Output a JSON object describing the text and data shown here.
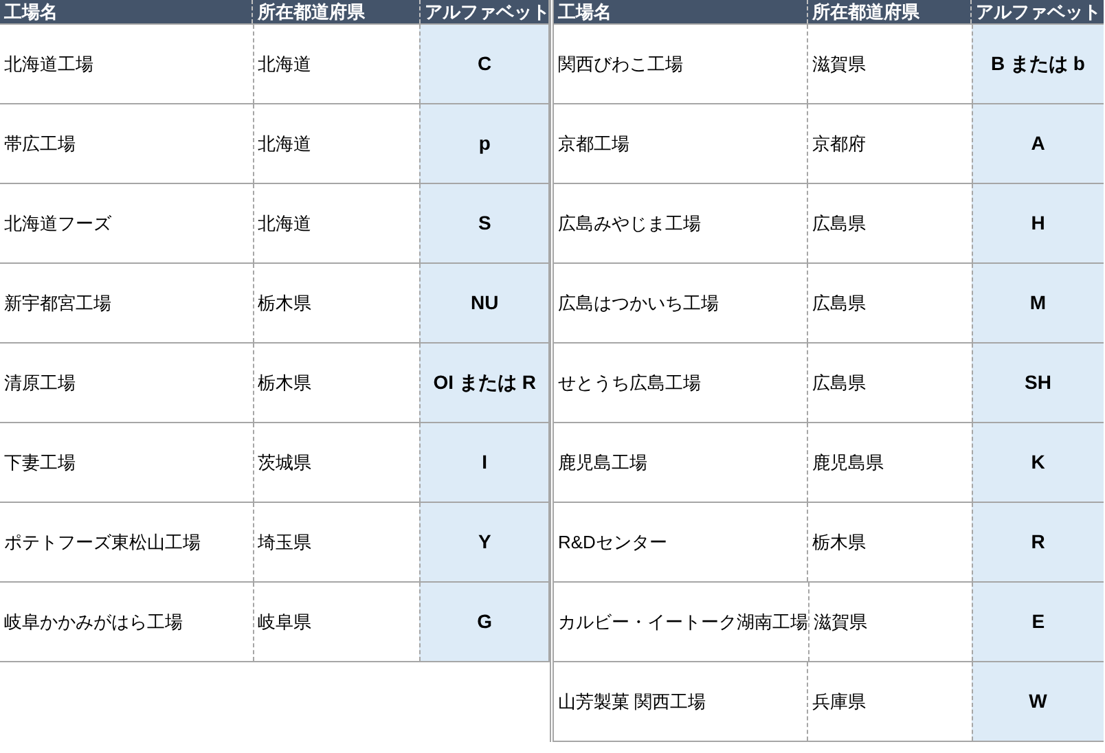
{
  "tables": [
    {
      "columns": [
        "工場名",
        "所在都道府県",
        "アルファベット"
      ],
      "rows": [
        {
          "name": "北海道工場",
          "prefecture": "北海道",
          "alphabet": "C"
        },
        {
          "name": "帯広工場",
          "prefecture": "北海道",
          "alphabet": "p"
        },
        {
          "name": "北海道フーズ",
          "prefecture": "北海道",
          "alphabet": "S"
        },
        {
          "name": "新宇都宮工場",
          "prefecture": "栃木県",
          "alphabet": "NU"
        },
        {
          "name": "清原工場",
          "prefecture": "栃木県",
          "alphabet": "OI または R"
        },
        {
          "name": "下妻工場",
          "prefecture": "茨城県",
          "alphabet": "I"
        },
        {
          "name": "ポテトフーズ東松山工場",
          "prefecture": "埼玉県",
          "alphabet": "Y"
        },
        {
          "name": "岐阜かかみがはら工場",
          "prefecture": "岐阜県",
          "alphabet": "G"
        }
      ]
    },
    {
      "columns": [
        "工場名",
        "所在都道府県",
        "アルファベット"
      ],
      "rows": [
        {
          "name": "関西びわこ工場",
          "prefecture": "滋賀県",
          "alphabet": "B または b"
        },
        {
          "name": "京都工場",
          "prefecture": "京都府",
          "alphabet": "A"
        },
        {
          "name": "広島みやじま工場",
          "prefecture": "広島県",
          "alphabet": "H"
        },
        {
          "name": "広島はつかいち工場",
          "prefecture": "広島県",
          "alphabet": "M"
        },
        {
          "name": "せとうち広島工場",
          "prefecture": "広島県",
          "alphabet": "SH"
        },
        {
          "name": "鹿児島工場",
          "prefecture": "鹿児島県",
          "alphabet": "K"
        },
        {
          "name": "R&Dセンター",
          "prefecture": "栃木県",
          "alphabet": "R"
        },
        {
          "name": "カルビー・イートーク湖南工場",
          "prefecture": "滋賀県",
          "alphabet": "E"
        },
        {
          "name": "山芳製菓 関西工場",
          "prefecture": "兵庫県",
          "alphabet": "W"
        }
      ]
    }
  ]
}
